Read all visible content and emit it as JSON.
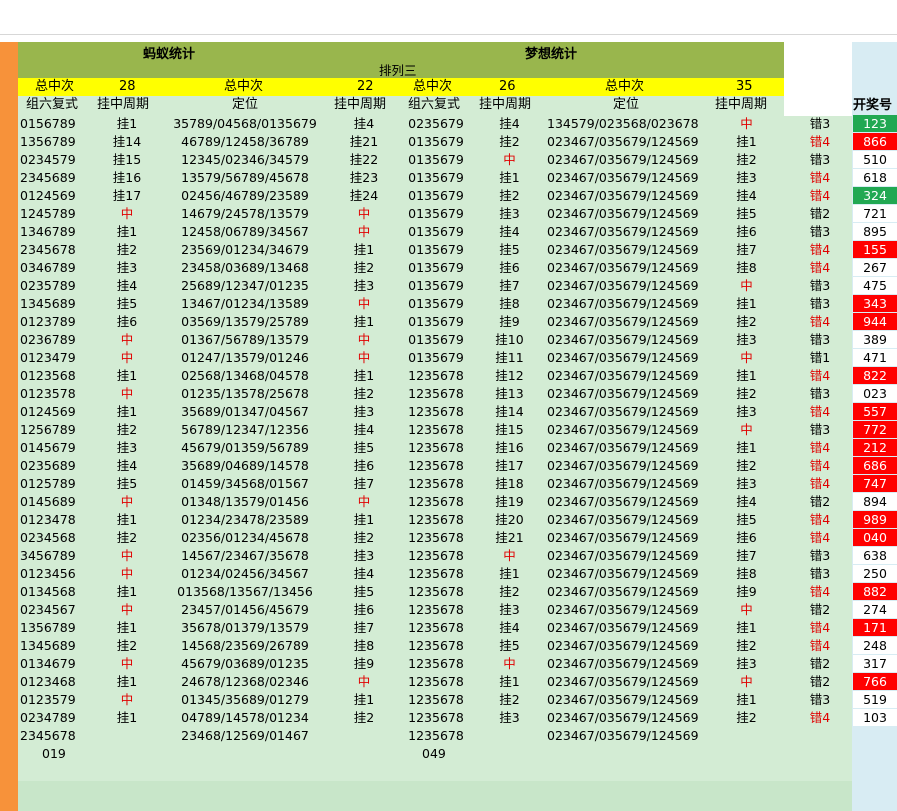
{
  "headers": {
    "left_title": "蚂蚁统计",
    "right_title": "梦想统计",
    "subtitle": "排列三",
    "total_label": "总中次",
    "left_a_count": "28",
    "left_b_count": "22",
    "right_a_count": "26",
    "right_b_count": "35",
    "col_zu": "组六复式",
    "col_gua": "挂中周期",
    "col_dw": "定位",
    "col_kj": "开奖号"
  },
  "rows": [
    [
      "0156789",
      "挂1",
      "35789/04568/0135679",
      "挂4",
      "0235679",
      "挂4",
      "134579/023568/023678",
      "中",
      "错3",
      "123",
      "g"
    ],
    [
      "1356789",
      "挂14",
      "46789/12458/36789",
      "挂21",
      "0135679",
      "挂2",
      "023467/035679/124569",
      "挂1",
      "错4",
      "866",
      "r"
    ],
    [
      "0234579",
      "挂15",
      "12345/02346/34579",
      "挂22",
      "0135679",
      "中",
      "023467/035679/124569",
      "挂2",
      "错3",
      "510",
      "n"
    ],
    [
      "2345689",
      "挂16",
      "13579/56789/45678",
      "挂23",
      "0135679",
      "挂1",
      "023467/035679/124569",
      "挂3",
      "错4",
      "618",
      "n"
    ],
    [
      "0124569",
      "挂17",
      "02456/46789/23589",
      "挂24",
      "0135679",
      "挂2",
      "023467/035679/124569",
      "挂4",
      "错4",
      "324",
      "g"
    ],
    [
      "1245789",
      "中",
      "14679/24578/13579",
      "中",
      "0135679",
      "挂3",
      "023467/035679/124569",
      "挂5",
      "错2",
      "721",
      "n"
    ],
    [
      "1346789",
      "挂1",
      "12458/06789/34567",
      "中",
      "0135679",
      "挂4",
      "023467/035679/124569",
      "挂6",
      "错3",
      "895",
      "n"
    ],
    [
      "2345678",
      "挂2",
      "23569/01234/34679",
      "挂1",
      "0135679",
      "挂5",
      "023467/035679/124569",
      "挂7",
      "错4",
      "155",
      "r"
    ],
    [
      "0346789",
      "挂3",
      "23458/03689/13468",
      "挂2",
      "0135679",
      "挂6",
      "023467/035679/124569",
      "挂8",
      "错4",
      "267",
      "n"
    ],
    [
      "0235789",
      "挂4",
      "25689/12347/01235",
      "挂3",
      "0135679",
      "挂7",
      "023467/035679/124569",
      "中",
      "错3",
      "475",
      "n"
    ],
    [
      "1345689",
      "挂5",
      "13467/01234/13589",
      "中",
      "0135679",
      "挂8",
      "023467/035679/124569",
      "挂1",
      "错3",
      "343",
      "r"
    ],
    [
      "0123789",
      "挂6",
      "03569/13579/25789",
      "挂1",
      "0135679",
      "挂9",
      "023467/035679/124569",
      "挂2",
      "错4",
      "944",
      "r"
    ],
    [
      "0236789",
      "中",
      "01367/56789/13579",
      "中",
      "0135679",
      "挂10",
      "023467/035679/124569",
      "挂3",
      "错3",
      "389",
      "n"
    ],
    [
      "0123479",
      "中",
      "01247/13579/01246",
      "中",
      "0135679",
      "挂11",
      "023467/035679/124569",
      "中",
      "错1",
      "471",
      "n"
    ],
    [
      "0123568",
      "挂1",
      "02568/13468/04578",
      "挂1",
      "1235678",
      "挂12",
      "023467/035679/124569",
      "挂1",
      "错4",
      "822",
      "r"
    ],
    [
      "0123578",
      "中",
      "01235/13578/25678",
      "挂2",
      "1235678",
      "挂13",
      "023467/035679/124569",
      "挂2",
      "错3",
      "023",
      "n"
    ],
    [
      "0124569",
      "挂1",
      "35689/01347/04567",
      "挂3",
      "1235678",
      "挂14",
      "023467/035679/124569",
      "挂3",
      "错4",
      "557",
      "r"
    ],
    [
      "1256789",
      "挂2",
      "56789/12347/12356",
      "挂4",
      "1235678",
      "挂15",
      "023467/035679/124569",
      "中",
      "错3",
      "772",
      "r"
    ],
    [
      "0145679",
      "挂3",
      "45679/01359/56789",
      "挂5",
      "1235678",
      "挂16",
      "023467/035679/124569",
      "挂1",
      "错4",
      "212",
      "r"
    ],
    [
      "0235689",
      "挂4",
      "35689/04689/14578",
      "挂6",
      "1235678",
      "挂17",
      "023467/035679/124569",
      "挂2",
      "错4",
      "686",
      "r"
    ],
    [
      "0125789",
      "挂5",
      "01459/34568/01567",
      "挂7",
      "1235678",
      "挂18",
      "023467/035679/124569",
      "挂3",
      "错4",
      "747",
      "r"
    ],
    [
      "0145689",
      "中",
      "01348/13579/01456",
      "中",
      "1235678",
      "挂19",
      "023467/035679/124569",
      "挂4",
      "错2",
      "894",
      "n"
    ],
    [
      "0123478",
      "挂1",
      "01234/23478/23589",
      "挂1",
      "1235678",
      "挂20",
      "023467/035679/124569",
      "挂5",
      "错4",
      "989",
      "r"
    ],
    [
      "0234568",
      "挂2",
      "02356/01234/45678",
      "挂2",
      "1235678",
      "挂21",
      "023467/035679/124569",
      "挂6",
      "错4",
      "040",
      "r"
    ],
    [
      "3456789",
      "中",
      "14567/23467/35678",
      "挂3",
      "1235678",
      "中",
      "023467/035679/124569",
      "挂7",
      "错3",
      "638",
      "n"
    ],
    [
      "0123456",
      "中",
      "01234/02456/34567",
      "挂4",
      "1235678",
      "挂1",
      "023467/035679/124569",
      "挂8",
      "错3",
      "250",
      "n"
    ],
    [
      "0134568",
      "挂1",
      "013568/13567/13456",
      "挂5",
      "1235678",
      "挂2",
      "023467/035679/124569",
      "挂9",
      "错4",
      "882",
      "r"
    ],
    [
      "0234567",
      "中",
      "23457/01456/45679",
      "挂6",
      "1235678",
      "挂3",
      "023467/035679/124569",
      "中",
      "错2",
      "274",
      "n"
    ],
    [
      "1356789",
      "挂1",
      "35678/01379/13579",
      "挂7",
      "1235678",
      "挂4",
      "023467/035679/124569",
      "挂1",
      "错4",
      "171",
      "r"
    ],
    [
      "1345689",
      "挂2",
      "14568/23569/26789",
      "挂8",
      "1235678",
      "挂5",
      "023467/035679/124569",
      "挂2",
      "错4",
      "248",
      "n"
    ],
    [
      "0134679",
      "中",
      "45679/03689/01235",
      "挂9",
      "1235678",
      "中",
      "023467/035679/124569",
      "挂3",
      "错2",
      "317",
      "n"
    ],
    [
      "0123468",
      "挂1",
      "24678/12368/02346",
      "中",
      "1235678",
      "挂1",
      "023467/035679/124569",
      "中",
      "错2",
      "766",
      "r"
    ],
    [
      "0123579",
      "中",
      "01345/35689/01279",
      "挂1",
      "1235678",
      "挂2",
      "023467/035679/124569",
      "挂1",
      "错3",
      "519",
      "n"
    ],
    [
      "0234789",
      "挂1",
      "04789/14578/01234",
      "挂2",
      "1235678",
      "挂3",
      "023467/035679/124569",
      "挂2",
      "错4",
      "103",
      "n"
    ],
    [
      "2345678",
      "",
      "23468/12569/01467",
      "",
      "1235678",
      "",
      "023467/035679/124569",
      "",
      "",
      "",
      ""
    ],
    [
      "019",
      "",
      "",
      "",
      "049",
      "",
      "",
      "",
      "",
      "",
      ""
    ]
  ]
}
